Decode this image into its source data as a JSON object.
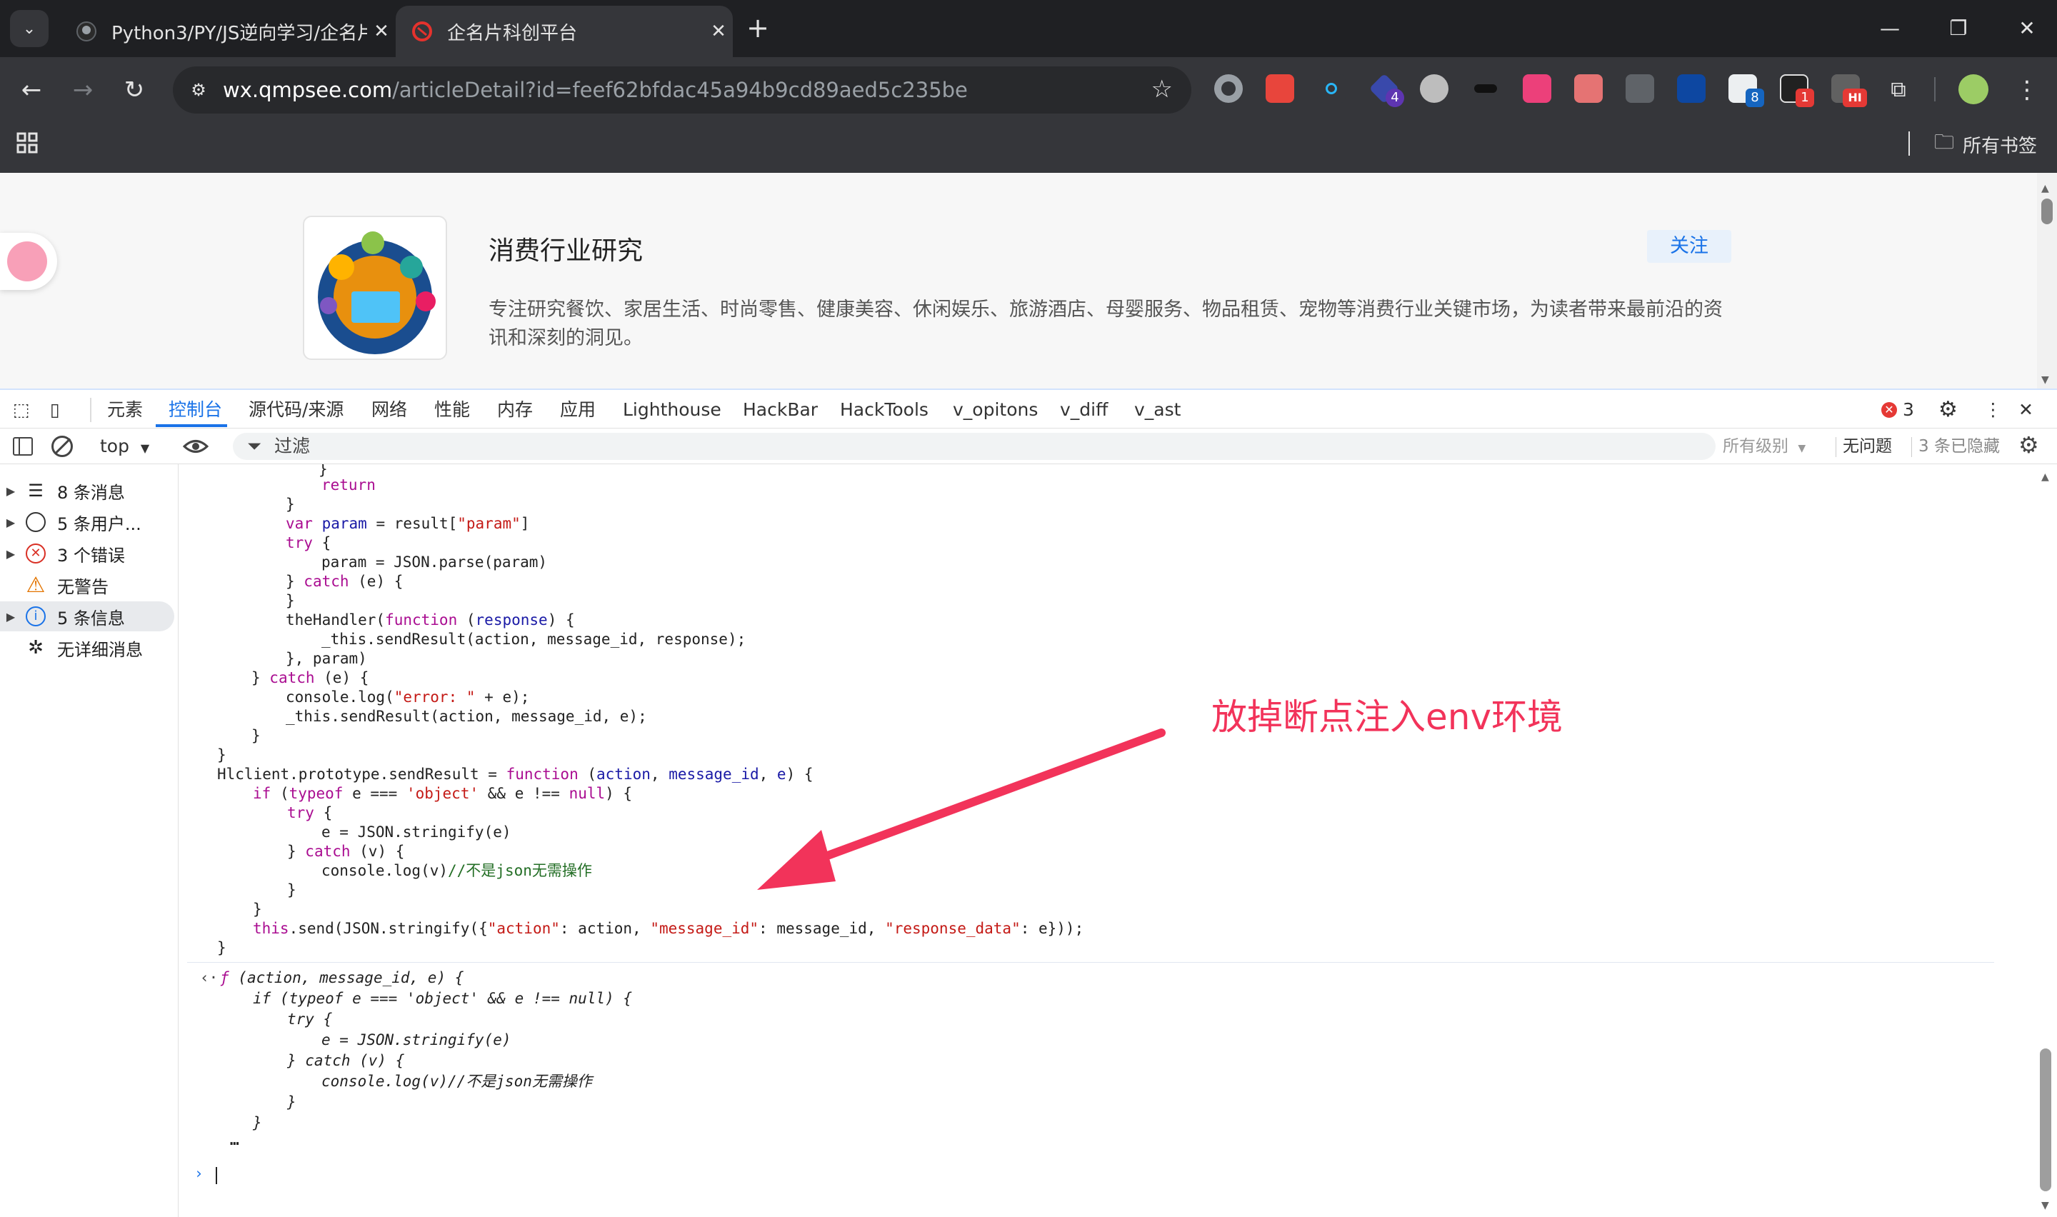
{
  "browser": {
    "tabs": [
      {
        "title": "Python3/PY/JS逆向学习/企名片",
        "icon": "github-icon"
      },
      {
        "title": "企名片科创平台",
        "icon": "qimingpian-icon",
        "active": true
      }
    ],
    "close_glyph": "✕",
    "new_tab_glyph": "+",
    "url_host": "wx.qmpsee.com",
    "url_path": "/articleDetail?id=feef62bfdac45a94b9cd89aed5c235be",
    "bookmarks_label": "所有书签",
    "extension_badges": {
      "ext4": "4",
      "ext14": "8",
      "ext15": "1",
      "ext16": "HI"
    }
  },
  "page": {
    "title": "消费行业研究",
    "follow_label": "关注",
    "description": "专注研究餐饮、家居生活、时尚零售、健康美容、休闲娱乐、旅游酒店、母婴服务、物品租赁、宠物等消费行业关键市场，为读者带来最前沿的资讯和深刻的洞见。"
  },
  "devtools": {
    "tabs": [
      "元素",
      "控制台",
      "源代码/来源",
      "网络",
      "性能",
      "内存",
      "应用",
      "Lighthouse",
      "HackBar",
      "HackTools",
      "v_opitons",
      "v_diff",
      "v_ast"
    ],
    "active_tab": "控制台",
    "error_count": "3",
    "context": "top",
    "filter_placeholder": "过滤",
    "levels": "所有级别",
    "no_issues": "无问题",
    "hidden_count": "3 条已隐藏",
    "sidebar": [
      {
        "label": "8 条消息",
        "icon": "list-icon"
      },
      {
        "label": "5 条用户...",
        "icon": "user-icon"
      },
      {
        "label": "3 个错误",
        "icon": "error-icon"
      },
      {
        "label": "无警告",
        "icon": "warning-icon"
      },
      {
        "label": "5 条信息",
        "icon": "info-icon"
      },
      {
        "label": "无详细消息",
        "icon": "bug-icon"
      }
    ]
  },
  "annotation": "放掉断点注入env环境"
}
